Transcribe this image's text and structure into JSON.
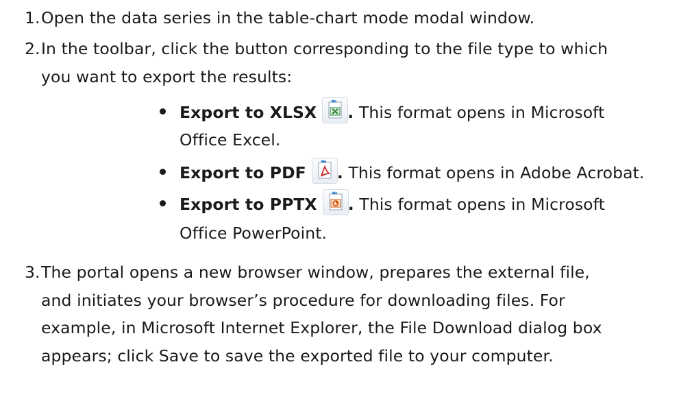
{
  "steps": [
    {
      "number": "1.",
      "text": "Open the data series in the table-chart mode modal window."
    },
    {
      "number": "2.",
      "text_line1": "In the toolbar, click the button corresponding to the file type to which",
      "text_line2": "you want to export the results:"
    },
    {
      "number": "3.",
      "lines": [
        "The portal opens a new browser window, prepares the external file,",
        "and initiates your browser’s procedure for downloading files. For",
        "example, in Microsoft Internet Explorer, the File Download dialog box",
        "appears; click Save to save the exported file to your computer."
      ]
    }
  ],
  "export_options": [
    {
      "label": "Export to XLSX",
      "icon": "excel-export-icon",
      "punct": ".",
      "desc_line1": "This format opens in Microsoft",
      "desc_line2": "Office Excel."
    },
    {
      "label": "Export to PDF",
      "icon": "pdf-export-icon",
      "punct": ".",
      "desc_line1": "This format opens in Adobe Acrobat."
    },
    {
      "label": "Export to PPTX",
      "icon": "powerpoint-export-icon",
      "punct": ".",
      "desc_line1": "This format opens in Microsoft",
      "desc_line2": "Office PowerPoint."
    }
  ],
  "colors": {
    "text": "#1a1a1a",
    "excel_green": "#2e8b3a",
    "pdf_red": "#d2232a",
    "ppt_orange": "#d35400",
    "arrow_blue": "#2f7fc8"
  }
}
